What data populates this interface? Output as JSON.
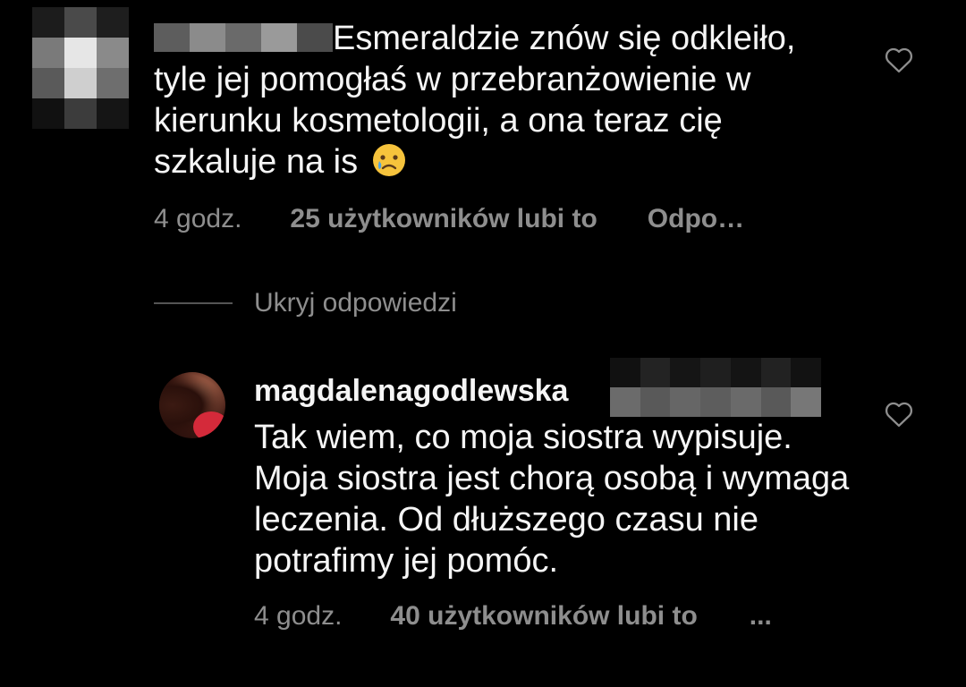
{
  "comment1": {
    "text": "Esmeraldzie znów się odkleiło, tyle jej pomogłaś w przebranżowienie w kierunku kosmetologii, a ona teraz cię szkaluje na is",
    "time": "4 godz.",
    "likes": "25 użytkowników lubi to",
    "reply": "Odpo…",
    "emoji": "crying-face"
  },
  "hide_replies": {
    "label": "Ukryj odpowiedzi"
  },
  "reply": {
    "username": "magdalenagodlewska",
    "text": "Tak wiem, co moja siostra wypisuje. Moja siostra jest chorą osobą i wymaga leczenia. Od dłuższego czasu nie potrafimy jej pomóc.",
    "time": "4 godz.",
    "likes": "40 użytkowników lubi to",
    "more": "..."
  },
  "icons": {
    "like": "heart-outline-icon",
    "more": "ellipsis-icon"
  },
  "colors": {
    "background": "#000000",
    "text": "#f5f5f5",
    "meta": "#8e8e8e",
    "divider": "#555555"
  }
}
